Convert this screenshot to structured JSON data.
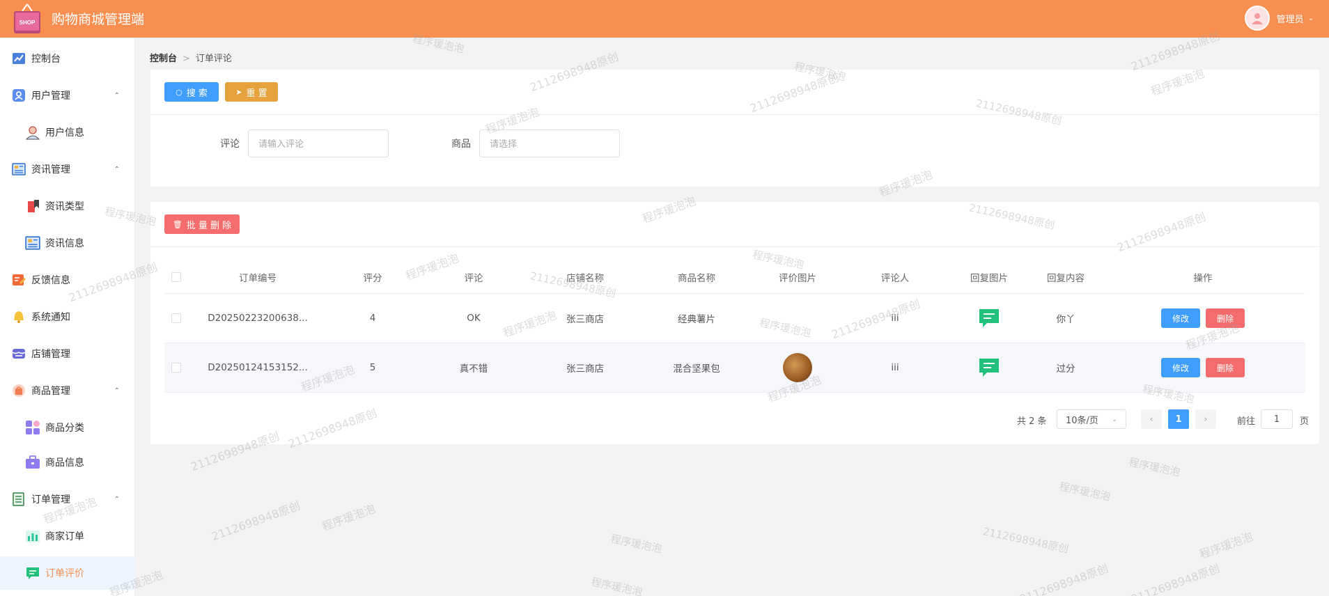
{
  "header": {
    "title": "购物商城管理端",
    "logo_text": "SHOP",
    "user_label": "管理员"
  },
  "sidebar": {
    "items": [
      {
        "label": "控制台",
        "icon": "chart-icon"
      },
      {
        "label": "用户管理",
        "icon": "user-icon",
        "expanded": true
      },
      {
        "label": "用户信息",
        "icon": "user-avatar-icon"
      },
      {
        "label": "资讯管理",
        "icon": "news-icon",
        "expanded": true
      },
      {
        "label": "资讯类型",
        "icon": "bookmark-icon"
      },
      {
        "label": "资讯信息",
        "icon": "news-icon"
      },
      {
        "label": "反馈信息",
        "icon": "feedback-icon"
      },
      {
        "label": "系统通知",
        "icon": "bell-icon"
      },
      {
        "label": "店铺管理",
        "icon": "shop-icon"
      },
      {
        "label": "商品管理",
        "icon": "bag-icon",
        "expanded": true
      },
      {
        "label": "商品分类",
        "icon": "grid-icon"
      },
      {
        "label": "商品信息",
        "icon": "briefcase-icon"
      },
      {
        "label": "订单管理",
        "icon": "list-icon",
        "expanded": true
      },
      {
        "label": "商家订单",
        "icon": "bar-chart-icon"
      },
      {
        "label": "订单评价",
        "icon": "comment-icon",
        "active": true
      }
    ]
  },
  "breadcrumb": {
    "home": "控制台",
    "current": "订单评论"
  },
  "search": {
    "search_btn": "搜 索",
    "reset_btn": "重 置",
    "comment_label": "评论",
    "comment_placeholder": "请输入评论",
    "product_label": "商品",
    "product_placeholder": "请选择"
  },
  "table": {
    "bulk_delete": "批 量 删 除",
    "columns": [
      "订单编号",
      "评分",
      "评论",
      "店铺名称",
      "商品名称",
      "评价图片",
      "评论人",
      "回复图片",
      "回复内容",
      "操作"
    ],
    "rows": [
      {
        "order_no": "D20250223200638...",
        "score": "4",
        "comment": "OK",
        "shop": "张三商店",
        "product": "经典薯片",
        "has_image": false,
        "reviewer": "iii",
        "reply": "你丫"
      },
      {
        "order_no": "D20250124153152...",
        "score": "5",
        "comment": "真不错",
        "shop": "张三商店",
        "product": "混合坚果包",
        "has_image": true,
        "reviewer": "iii",
        "reply": "过分"
      }
    ],
    "edit_label": "修改",
    "delete_label": "删除"
  },
  "pager": {
    "total": "共 2 条",
    "page_size": "10条/页",
    "current": "1",
    "goto_prefix": "前往",
    "goto_value": "1",
    "goto_suffix": "页"
  },
  "watermark": {
    "text_a": "程序瑗泡泡",
    "text_b": "2112698948原创"
  },
  "colors": {
    "header": "#f88f51",
    "primary": "#409eff",
    "warning": "#e6a23c",
    "danger": "#f56c6c"
  }
}
